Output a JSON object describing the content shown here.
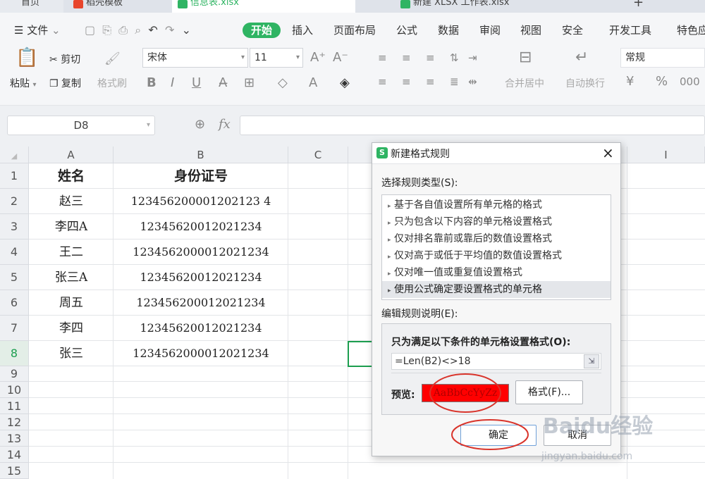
{
  "tabs": [
    {
      "label": "首页",
      "icon": "home-icon"
    },
    {
      "label": "稻壳模板",
      "icon": "docer-icon"
    },
    {
      "label": "信息表.xlsx",
      "icon": "sheet-icon"
    },
    {
      "label": "新建 XLSX 工作表.xlsx",
      "icon": "sheet-icon"
    },
    {
      "label": "+"
    }
  ],
  "menubar": {
    "file": "文件",
    "items": [
      "开始",
      "插入",
      "页面布局",
      "公式",
      "数据",
      "审阅",
      "视图",
      "安全",
      "开发工具",
      "特色应"
    ]
  },
  "ribbon": {
    "paste": "粘贴",
    "cut": "剪切",
    "copy": "复制",
    "format_painter": "格式刷",
    "font_name": "宋体",
    "font_size": "11",
    "merge_center": "合并居中",
    "wrap_text": "自动换行",
    "number_format": "常规",
    "percent": "%"
  },
  "formula_bar": {
    "name_box": "D8",
    "fx": "fx",
    "formula": ""
  },
  "columns": [
    "A",
    "B",
    "C",
    "I"
  ],
  "rows": [
    "1",
    "2",
    "3",
    "4",
    "5",
    "6",
    "7",
    "8",
    "9",
    "10",
    "11",
    "12",
    "13",
    "14",
    "15"
  ],
  "sheet": {
    "header": {
      "a": "姓名",
      "b": "身份证号"
    },
    "data": [
      {
        "name": "赵三",
        "id": "123456200001202123 4"
      },
      {
        "name": "李四A",
        "id": "12345620012021234"
      },
      {
        "name": "王二",
        "id": "1234562000012021234"
      },
      {
        "name": "张三A",
        "id": "12345620012021234"
      },
      {
        "name": "周五",
        "id": "123456200012021234"
      },
      {
        "name": "李四",
        "id": "12345620012021234"
      },
      {
        "name": "张三",
        "id": "1234562000012021234"
      }
    ]
  },
  "dialog": {
    "title": "新建格式规则",
    "close": "×",
    "select_rule_type": "选择规则类型(S):",
    "rule_types": [
      "基于各自值设置所有单元格的格式",
      "只为包含以下内容的单元格设置格式",
      "仅对排名靠前或靠后的数值设置格式",
      "仅对高于或低于平均值的数值设置格式",
      "仅对唯一值或重复值设置格式",
      "使用公式确定要设置格式的单元格"
    ],
    "edit_rule_desc": "编辑规则说明(E):",
    "condition_label": "只为满足以下条件的单元格设置格式(O):",
    "formula": "=Len(B2)<>18",
    "preview_label": "预览:",
    "preview_text": "AaBbCcYyZz",
    "format_button": "格式(F)...",
    "ok_button": "确定",
    "cancel_button": "取消"
  },
  "watermark": {
    "main": "Baidu经验",
    "sub": "jingyan.baidu.com"
  },
  "colors": {
    "accent": "#2fb463",
    "preview_bg": "#ff0000",
    "annotation": "#d9342b"
  }
}
